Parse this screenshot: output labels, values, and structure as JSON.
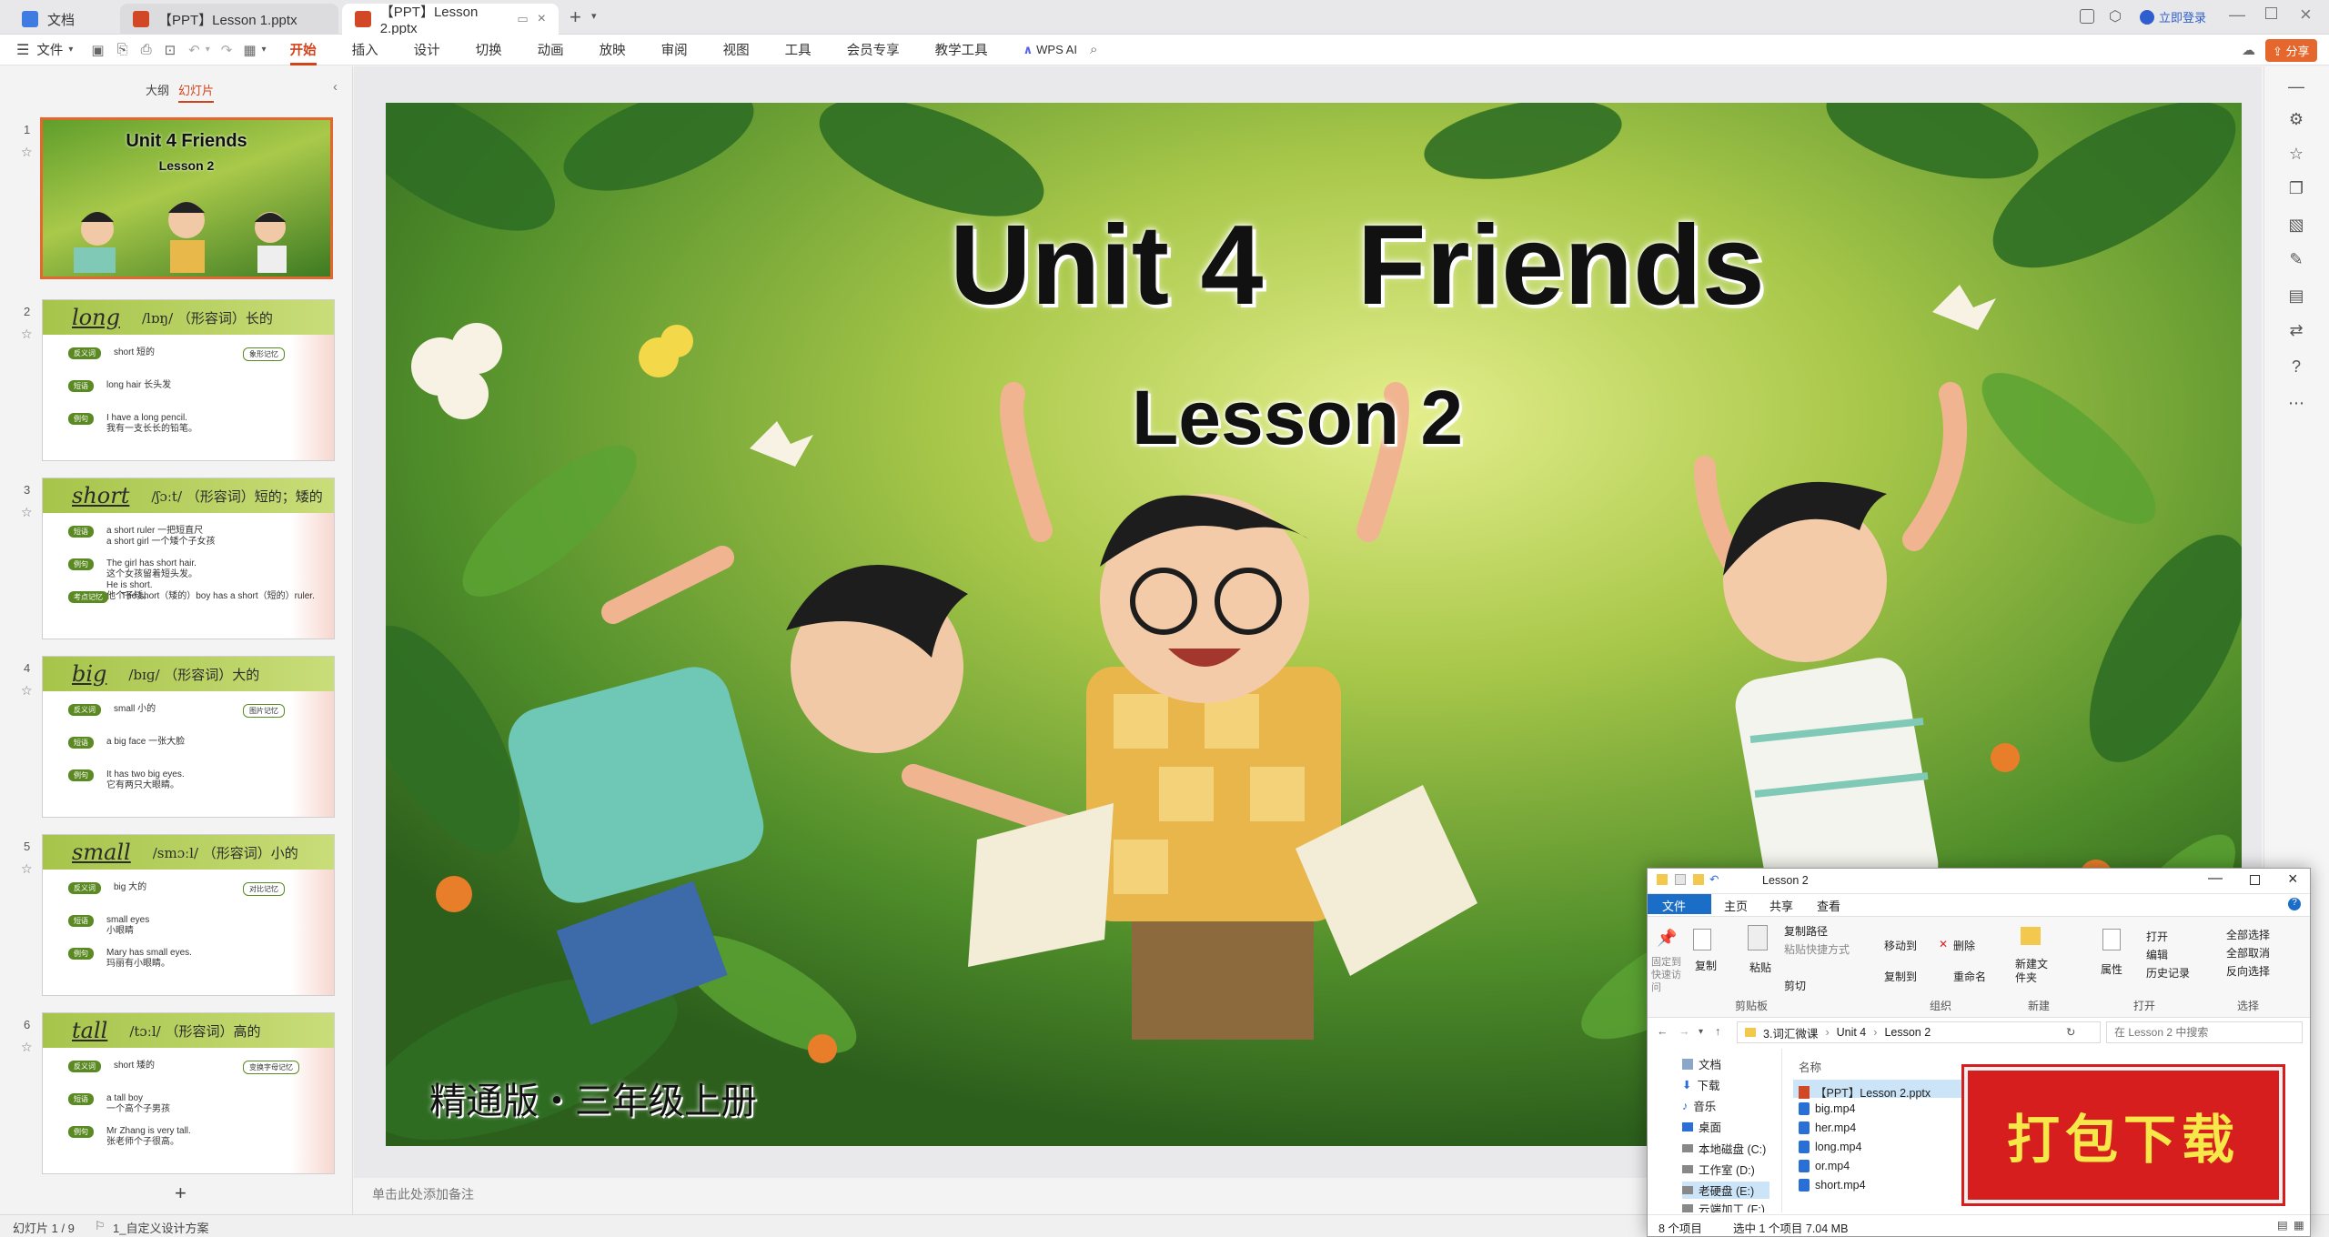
{
  "titlebar": {
    "tabs": [
      {
        "label": "文档"
      },
      {
        "label": "【PPT】Lesson 1.pptx"
      },
      {
        "label": "【PPT】Lesson 2.pptx"
      }
    ],
    "login": "立即登录"
  },
  "menubar": {
    "file": "文件",
    "items": [
      "开始",
      "插入",
      "设计",
      "切换",
      "动画",
      "放映",
      "审阅",
      "视图",
      "工具",
      "会员专享",
      "教学工具"
    ],
    "wps_ai": "WPS AI",
    "share": "分享"
  },
  "leftpanel": {
    "tab_outline": "大纲",
    "tab_slides": "幻灯片",
    "slides": [
      {
        "num": "1",
        "title": "Unit 4  Friends",
        "subtitle": "Lesson 2"
      },
      {
        "num": "2",
        "word": "long",
        "phonetic": "/lɒŋ/ （形容词）长的",
        "rows": [
          [
            "反义词",
            "short  短的"
          ],
          [
            "短语",
            "long hair  长头发"
          ],
          [
            "例句",
            "I have a long pencil.\n我有一支长长的铅笔。"
          ]
        ],
        "side": "象形记忆"
      },
      {
        "num": "3",
        "word": "short",
        "phonetic": "/ʃɔːt/ （形容词）短的；矮的",
        "rows": [
          [
            "短语",
            "a short ruler  一把短直尺\na short girl  一个矮个子女孩"
          ],
          [
            "例句",
            "The girl has short hair.\n这个女孩留着短头发。\nHe is short.\n他个子矮。"
          ],
          [
            "考点记忆",
            "The short（矮的）boy has a short（短的）ruler."
          ]
        ],
        "side": ""
      },
      {
        "num": "4",
        "word": "big",
        "phonetic": "/bɪɡ/ （形容词）大的",
        "rows": [
          [
            "反义词",
            "small  小的"
          ],
          [
            "短语",
            "a big face  一张大脸"
          ],
          [
            "例句",
            "It has two big eyes.\n它有两只大眼睛。"
          ]
        ],
        "side": "图片记忆"
      },
      {
        "num": "5",
        "word": "small",
        "phonetic": "/smɔːl/ （形容词）小的",
        "rows": [
          [
            "反义词",
            "big  大的"
          ],
          [
            "短语",
            "small eyes\n小眼睛"
          ],
          [
            "例句",
            "Mary has small eyes.\n玛丽有小眼睛。"
          ]
        ],
        "side": "对比记忆"
      },
      {
        "num": "6",
        "word": "tall",
        "phonetic": "/tɔːl/ （形容词）高的",
        "rows": [
          [
            "反义词",
            "short  矮的"
          ],
          [
            "短语",
            "a tall boy\n一个高个子男孩"
          ],
          [
            "例句",
            "Mr Zhang is very tall.\n张老师个子很高。"
          ]
        ],
        "side": "变换字母记忆"
      }
    ],
    "add_button": "+"
  },
  "slide": {
    "title": "Unit 4   Friends",
    "subtitle": "Lesson 2",
    "footer": "精通版・三年级上册"
  },
  "notes_placeholder": "单击此处添加备注",
  "status": {
    "slide_counter": "幻灯片 1 / 9",
    "design": "1_自定义设计方案"
  },
  "explorer": {
    "title": "Lesson 2",
    "ribbon_tabs": [
      "文件",
      "主页",
      "共享",
      "查看"
    ],
    "buttons": {
      "pin": "固定到快速访问",
      "copy": "复制",
      "paste": "粘贴",
      "copy_path": "复制路径",
      "paste_shortcut": "粘贴快捷方式",
      "cut": "剪切",
      "move_to": "移动到",
      "copy_to": "复制到",
      "delete": "删除",
      "rename": "重命名",
      "new_folder": "新建文件夹",
      "properties": "属性",
      "open": "打开",
      "edit": "编辑",
      "history": "历史记录",
      "select_all": "全部选择",
      "select_none": "全部取消",
      "invert": "反向选择"
    },
    "groups": [
      "剪贴板",
      "组织",
      "新建",
      "打开",
      "选择"
    ],
    "breadcrumb": [
      "3.词汇微课",
      "Unit 4",
      "Lesson 2"
    ],
    "search_placeholder": "在 Lesson 2 中搜索",
    "nav": [
      "文档",
      "下载",
      "音乐",
      "桌面",
      "本地磁盘 (C:)",
      "工作室 (D:)",
      "老硬盘 (E:)",
      "云端加工 (F:)"
    ],
    "column_name": "名称",
    "files": [
      "【PPT】Lesson 2.pptx",
      "big.mp4",
      "her.mp4",
      "long.mp4",
      "or.mp4",
      "short.mp4"
    ],
    "status_count": "8 个项目",
    "status_selected": "选中 1 个项目  7.04 MB"
  },
  "watermark": "打包下载"
}
